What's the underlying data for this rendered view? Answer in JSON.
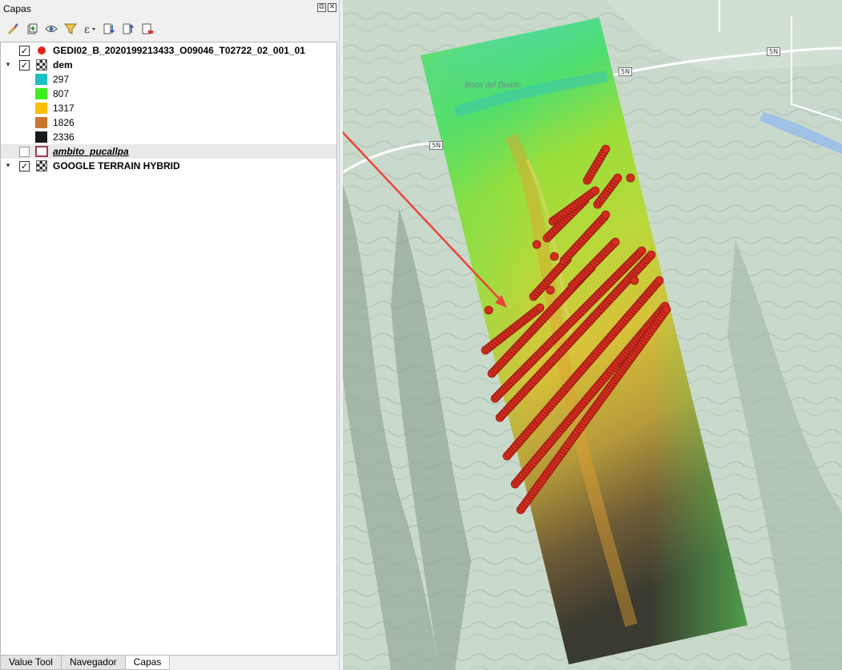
{
  "panel": {
    "title": "Capas",
    "float_glyph": "⧉",
    "close_glyph": "✕"
  },
  "toolbar": [
    {
      "name": "style-manager-icon"
    },
    {
      "name": "add-group-icon"
    },
    {
      "name": "visibility-icon"
    },
    {
      "name": "filter-icon"
    },
    {
      "name": "expression-filter-icon"
    },
    {
      "name": "expand-all-icon"
    },
    {
      "name": "collapse-all-icon"
    },
    {
      "name": "remove-layer-icon"
    }
  ],
  "layers": {
    "gedi": {
      "label": "GEDI02_B_2020199213433_O09046_T02722_02_001_01",
      "checked": "✓",
      "color": "#e2231a"
    },
    "dem": {
      "label": "dem",
      "checked": "✓",
      "expand": "▾"
    },
    "ambito": {
      "label": "ambito_pucallpa",
      "border_color": "#9c3e52"
    },
    "google": {
      "label": "GOOGLE TERRAIN HYBRID",
      "checked": "✓",
      "expand": "▾"
    }
  },
  "legend": [
    {
      "value": "297",
      "color": "#1bc0c0"
    },
    {
      "value": "807",
      "color": "#3cf01c"
    },
    {
      "value": "1317",
      "color": "#ffbf00"
    },
    {
      "value": "1826",
      "color": "#c8782e"
    },
    {
      "value": "2336",
      "color": "#1a1a1a"
    }
  ],
  "tabs": [
    {
      "label": "Value Tool"
    },
    {
      "label": "Navegador"
    },
    {
      "label": "Capas",
      "active": true
    }
  ],
  "map": {
    "road_labels": [
      "5N",
      "5N",
      "5N"
    ],
    "place_label": "Boca del Diablo",
    "arrow_color": "#e8463a",
    "point_color": "#d42c1e"
  }
}
